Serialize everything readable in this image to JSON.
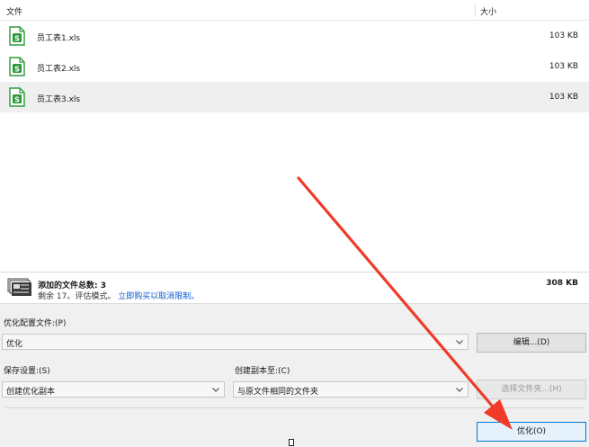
{
  "list": {
    "columns": {
      "name": "文件",
      "size": "大小"
    },
    "files": [
      {
        "name": "员工表1.xls",
        "size": "103 KB",
        "icon": "xls-file-icon"
      },
      {
        "name": "员工表2.xls",
        "size": "103 KB",
        "icon": "xls-file-icon"
      },
      {
        "name": "员工表3.xls",
        "size": "103 KB",
        "icon": "xls-file-icon",
        "selected": true
      }
    ]
  },
  "summary": {
    "title": "添加的文件总数: 3",
    "remaining": "剩余 17。评估模式。",
    "link": "立即购买以取消限制。",
    "total_size": "308 KB"
  },
  "settings": {
    "profile_label": "优化配置文件:(P)",
    "profile_value": "优化",
    "edit_button": "编辑...(D)",
    "save_label": "保存设置:(S)",
    "save_value": "创建优化副本",
    "copy_label": "创建副本至:(C)",
    "copy_value": "与原文件相同的文件夹",
    "choose_folder_button": "选择文件夹...(H)",
    "optimize_button": "优化(O)"
  },
  "colors": {
    "xls_icon": "#2e9a3c",
    "link": "#0b57d0",
    "annotation_arrow": "#f03a2a",
    "primary_border": "#0078d7"
  }
}
